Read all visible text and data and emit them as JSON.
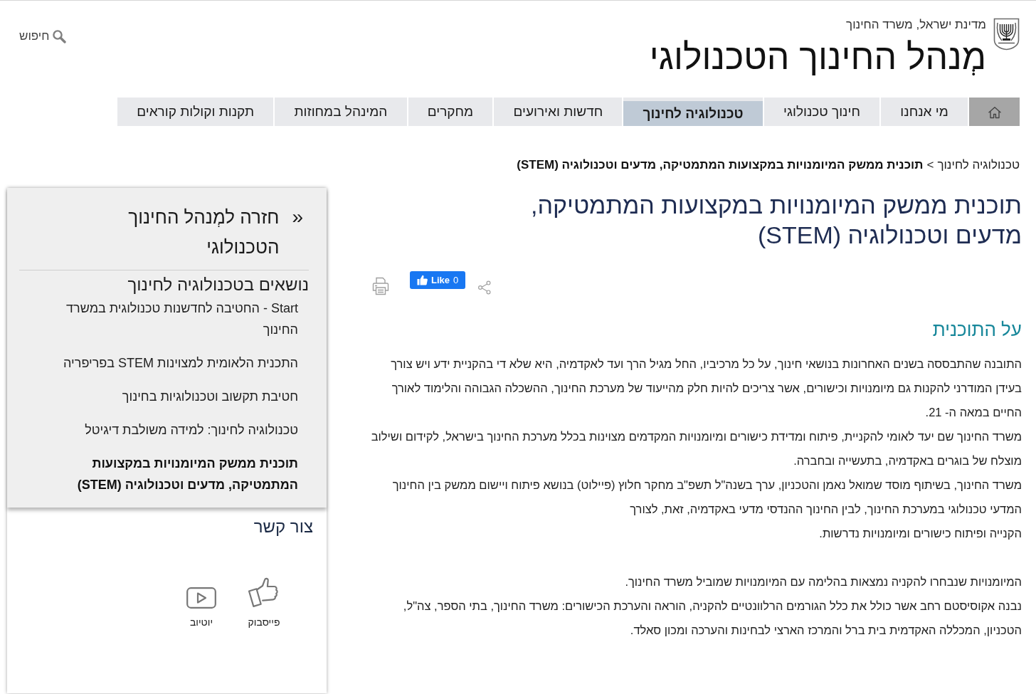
{
  "header": {
    "subtitle": "מדינת ישראל, משרד החינוך",
    "title": "מְנהל החינוך הטכנולוגי",
    "search": {
      "label": "חיפוש"
    }
  },
  "nav": {
    "tabs": [
      {
        "kind": "home",
        "selected": false
      },
      {
        "kind": "link",
        "label": "מי אנחנו",
        "selected": false
      },
      {
        "kind": "link",
        "label": "חינוך טכנולוגי",
        "selected": false
      },
      {
        "kind": "link",
        "label": "טכנולוגיה לחינוך",
        "selected": true
      },
      {
        "kind": "link",
        "label": "חדשות ואירועים",
        "selected": false
      },
      {
        "kind": "link",
        "label": "מחקרים",
        "selected": false
      },
      {
        "kind": "link",
        "label": "המינהל במחוזות",
        "selected": false
      },
      {
        "kind": "link",
        "label": "תקנות וקולות קוראים",
        "selected": false
      }
    ]
  },
  "breadcrumb": {
    "separator": ">",
    "items": [
      {
        "label": "טכנולוגיה לחינוך",
        "current": false
      },
      {
        "label": "תוכנית ממשק המיומנויות במקצועות המתמטיקה, מדעים וטכנולוגיה (STEM)",
        "current": true
      }
    ]
  },
  "page": {
    "title": "תוכנית ממשק המיומנויות במקצועות המתמטיקה, מדעים וטכנולוגיה (STEM)",
    "like_button": {
      "label": "Like",
      "count": "0"
    },
    "sections": [
      {
        "heading": "על התוכנית",
        "blocks": [
          {
            "paragraphs": [
              "התובנה שהתבססה בשנים האחרונות בנושאי חינוך, על כל מרכיביו, החל מגיל הרך ועד לאקדמיה, היא שלא די בהקניית ידע ויש צורך בעידן המודרני להקנות גם מיומנויות וכישורים, אשר צריכים להיות חלק מהייעוד של מערכת החינוך, ההשכלה הגבוהה והלימוד לאורך החיים במאה ה- 21.",
              "משרד החינוך שם יעד לאומי להקניית, פיתוח ומדידת כישורים ומיומנויות המקדמים מצוינות בכלל מערכת החינוך בישראל, לקידום ושילוב מוצלח של בוגרים באקדמיה, בתעשייה ובחברה.",
              "משרד החינוך, בשיתוף מוסד שמואל נאמן והטכניון, ערך בשנה\"ל תשפ\"ב מחקר חלוץ (פיילוט) בנושא פיתוח ויישום ממשק בין החינוך המדעי טכנולוגי במערכת החינוך, לבין החינוך ההנדסי מדעי באקדמיה, זאת, לצורך\nהקנייה ופיתוח כישורים ומיומנויות נדרשות."
            ]
          },
          {
            "paragraphs": [
              "המיומנויות שנבחרו להקניה נמצאות בהלימה עם המיומנויות שמוביל משרד החינוך.",
              "נבנה אקוסיסטם רחב אשר כולל את כלל הגורמים הרלוונטיים להקניה, הוראה והערכת הכישורים: משרד החינוך, בתי הספר, צה\"ל, הטכניון, המכללה האקדמית בית ברל והמרכז הארצי לבחינות והערכה ומכון סאלד."
            ]
          }
        ]
      }
    ]
  },
  "sidebar": {
    "back_link": {
      "arrow": "»",
      "label": "חזרה למְנהל החינוך הטכנולוגי"
    },
    "heading": "נושאים בטכנולוגיה לחינוך",
    "items": [
      {
        "label": "Start - החטיבה לחדשנות טכנולוגית במשרד החינוך",
        "selected": false
      },
      {
        "label": "התכנית הלאומית למצוינות STEM בפריפריה",
        "selected": false
      },
      {
        "label": "חטיבת תקשוב וטכנולוגיות בחינוך",
        "selected": false
      },
      {
        "label": "טכנולוגיה לחינוך: למידה משולבת דיגיטל",
        "selected": false
      },
      {
        "label": "תוכנית ממשק המיומנויות במקצועות המתמטיקה, מדעים וטכנולוגיה (STEM)",
        "selected": true
      }
    ],
    "contact": {
      "heading": "צור קשר",
      "links": [
        {
          "kind": "thumb",
          "label": "פייסבוק"
        },
        {
          "kind": "video",
          "label": "יוטיוב"
        }
      ]
    }
  }
}
